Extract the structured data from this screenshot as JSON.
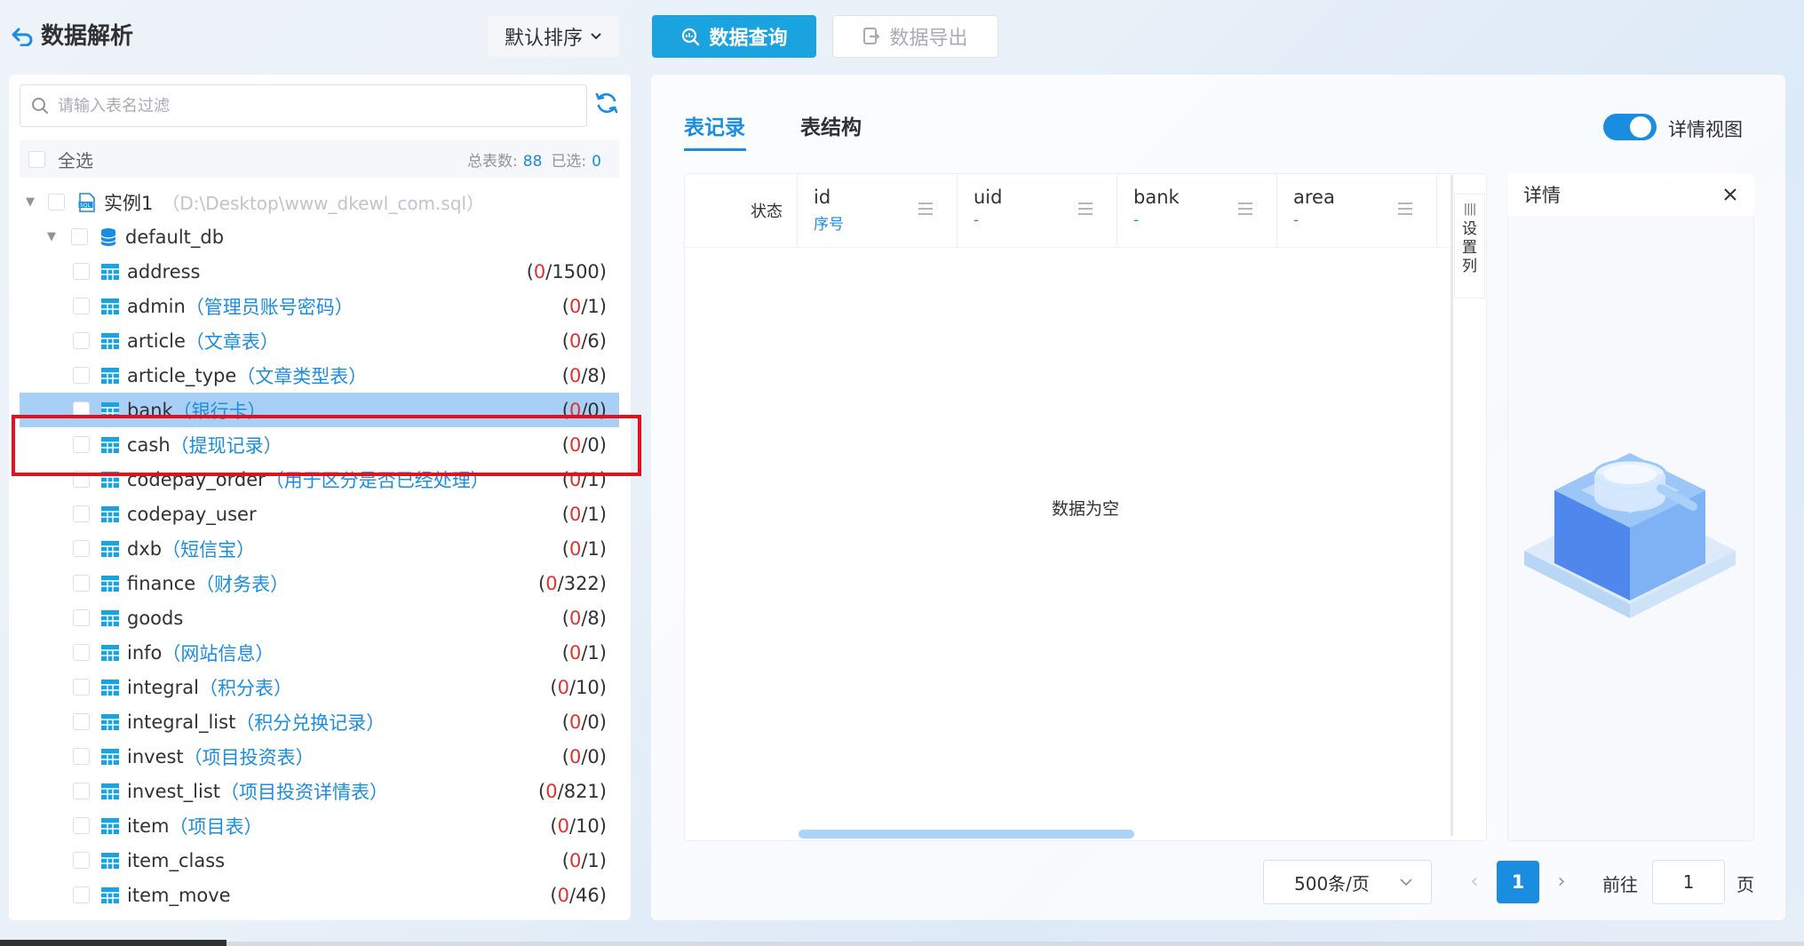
{
  "header": {
    "title": "数据解析",
    "sort_label": "默认排序",
    "query_label": "数据查询",
    "export_label": "数据导出"
  },
  "left": {
    "search_placeholder": "请输入表名过滤",
    "select_all_label": "全选",
    "total_label": "总表数:",
    "total_count": "88",
    "selected_label": "已选:",
    "selected_count": "0",
    "instance": {
      "name": "实例1",
      "path": "（D:\\Desktop\\www_dkewl_com.sql）"
    },
    "database": {
      "name": "default_db"
    },
    "tables": [
      {
        "name": "address",
        "comment": "",
        "sel": "0",
        "total": "1500"
      },
      {
        "name": "admin",
        "comment": "（管理员账号密码）",
        "sel": "0",
        "total": "1"
      },
      {
        "name": "article",
        "comment": "（文章表）",
        "sel": "0",
        "total": "6"
      },
      {
        "name": "article_type",
        "comment": "（文章类型表）",
        "sel": "0",
        "total": "8"
      },
      {
        "name": "bank",
        "comment": "（银行卡）",
        "sel": "0",
        "total": "0"
      },
      {
        "name": "cash",
        "comment": "（提现记录）",
        "sel": "0",
        "total": "0"
      },
      {
        "name": "codepay_order",
        "comment": "（用于区分是否已经处理）",
        "sel": "0",
        "total": "1"
      },
      {
        "name": "codepay_user",
        "comment": "",
        "sel": "0",
        "total": "1"
      },
      {
        "name": "dxb",
        "comment": "（短信宝）",
        "sel": "0",
        "total": "1"
      },
      {
        "name": "finance",
        "comment": "（财务表）",
        "sel": "0",
        "total": "322"
      },
      {
        "name": "goods",
        "comment": "",
        "sel": "0",
        "total": "8"
      },
      {
        "name": "info",
        "comment": "（网站信息）",
        "sel": "0",
        "total": "1"
      },
      {
        "name": "integral",
        "comment": "（积分表）",
        "sel": "0",
        "total": "10"
      },
      {
        "name": "integral_list",
        "comment": "（积分兑换记录）",
        "sel": "0",
        "total": "0"
      },
      {
        "name": "invest",
        "comment": "（项目投资表）",
        "sel": "0",
        "total": "0"
      },
      {
        "name": "invest_list",
        "comment": "（项目投资详情表）",
        "sel": "0",
        "total": "821"
      },
      {
        "name": "item",
        "comment": "（项目表）",
        "sel": "0",
        "total": "10"
      },
      {
        "name": "item_class",
        "comment": "",
        "sel": "0",
        "total": "1"
      },
      {
        "name": "item_move",
        "comment": "",
        "sel": "0",
        "total": "46"
      }
    ]
  },
  "right": {
    "tabs": {
      "records": "表记录",
      "structure": "表结构"
    },
    "detail_view_label": "详情视图",
    "status_header": "状态",
    "columns": [
      {
        "name": "id",
        "sub": "序号"
      },
      {
        "name": "uid",
        "sub": "-"
      },
      {
        "name": "bank",
        "sub": "-"
      },
      {
        "name": "area",
        "sub": "-"
      }
    ],
    "column_setting": [
      "设",
      "置",
      "列"
    ],
    "empty_text": "数据为空",
    "detail_title": "详情"
  },
  "pagination": {
    "page_size": "500条/页",
    "current_page": "1",
    "goto_label": "前往",
    "goto_value": "1",
    "page_unit": "页"
  },
  "colors": {
    "accent": "#1a8de0",
    "query_button": "#1aa3de",
    "selected_row": "#a8d0f6",
    "highlight_box": "#e6101c",
    "count_red": "#e0312f"
  }
}
